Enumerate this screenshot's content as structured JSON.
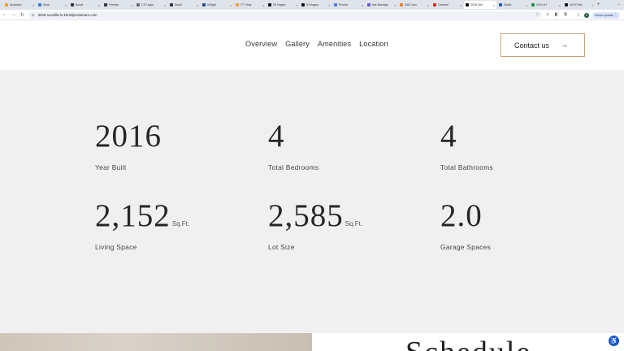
{
  "browser": {
    "tabs": [
      {
        "title": "Analytics",
        "color": "#f4a300"
      },
      {
        "title": "Desk",
        "color": "#3a7bd5"
      },
      {
        "title": "Boost",
        "color": "#333333"
      },
      {
        "title": "Preview",
        "color": "#333333"
      },
      {
        "title": "CS Login",
        "color": "#6a6a6a"
      },
      {
        "title": "Boost",
        "color": "#333333"
      },
      {
        "title": "InSight",
        "color": "#1f4f8f"
      },
      {
        "title": "777 Hwy",
        "color": "#f0a030"
      },
      {
        "title": "30 Hagen",
        "color": "#111111"
      },
      {
        "title": "30 Hagen",
        "color": "#111111"
      },
      {
        "title": "Photos",
        "color": "#4285f4"
      },
      {
        "title": "Ads Manage",
        "color": "#6a5acd"
      },
      {
        "title": "336 Cam",
        "color": "#f08030"
      },
      {
        "title": "Channel",
        "color": "#e02020"
      },
      {
        "title": "3026 Sev",
        "color": "#111111",
        "active": true
      },
      {
        "title": "Distric",
        "color": "#2060c0"
      },
      {
        "title": "2024 KJ",
        "color": "#1e8e3e"
      },
      {
        "title": "150 El Niv",
        "color": "#111111"
      }
    ],
    "url": "3026-sonsilla-ln.khristijervisteam.com",
    "profile_initial": "K",
    "finish_update_label": "Finish update"
  },
  "site": {
    "nav": [
      "Overview",
      "Gallery",
      "Amenities",
      "Location"
    ],
    "contact_label": "Contact us",
    "accent_color": "#c9a27d"
  },
  "stats": [
    {
      "value": "2016",
      "unit": "",
      "label": "Year Built"
    },
    {
      "value": "4",
      "unit": "",
      "label": "Total Bedrooms"
    },
    {
      "value": "4",
      "unit": "",
      "label": "Total Bathrooms"
    },
    {
      "value": "2,152",
      "unit": "Sq.Ft.",
      "label": "Living Space"
    },
    {
      "value": "2,585",
      "unit": "Sq.Ft.",
      "label": "Lot Size"
    },
    {
      "value": "2.0",
      "unit": "",
      "label": "Garage Spaces"
    }
  ],
  "schedule_heading": "Schedule",
  "icons": {
    "back": "arrow-left-icon",
    "forward": "arrow-right-icon",
    "reload": "reload-icon",
    "bookmark": "star-icon",
    "accessibility": "accessibility-icon"
  }
}
